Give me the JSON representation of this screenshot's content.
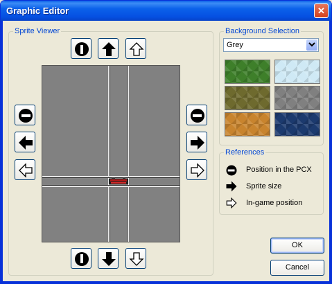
{
  "window": {
    "title": "Graphic Editor",
    "close_glyph": "✕"
  },
  "sprite_viewer": {
    "label": "Sprite Viewer",
    "icons": {
      "up": [
        "pcx-position-up-icon",
        "sprite-size-up-icon",
        "ingame-position-up-icon"
      ],
      "down": [
        "pcx-position-down-icon",
        "sprite-size-down-icon",
        "ingame-position-down-icon"
      ],
      "left": [
        "pcx-position-left-icon",
        "sprite-size-left-icon",
        "ingame-position-left-icon"
      ],
      "right": [
        "pcx-position-right-icon",
        "sprite-size-right-icon",
        "ingame-position-right-icon"
      ]
    },
    "background_color": "#818181"
  },
  "background_selection": {
    "label": "Background Selection",
    "selected": "Grey",
    "tiles": [
      {
        "name": "grass",
        "color": "#3E7F2A"
      },
      {
        "name": "snow",
        "color": "#CFE9F5"
      },
      {
        "name": "swamp",
        "color": "#6E6A2E"
      },
      {
        "name": "grey",
        "color": "#808080"
      },
      {
        "name": "desert",
        "color": "#C8842E"
      },
      {
        "name": "water",
        "color": "#1C3A6E"
      }
    ]
  },
  "references": {
    "label": "References",
    "items": [
      {
        "icon": "pcx-position-icon",
        "text": "Position in the PCX"
      },
      {
        "icon": "sprite-size-icon",
        "text": "Sprite size"
      },
      {
        "icon": "ingame-position-icon",
        "text": "In-game position"
      }
    ]
  },
  "buttons": {
    "ok": "OK",
    "cancel": "Cancel"
  },
  "colors": {
    "accent": "#0046D5",
    "titlebar": "#0550E2"
  }
}
